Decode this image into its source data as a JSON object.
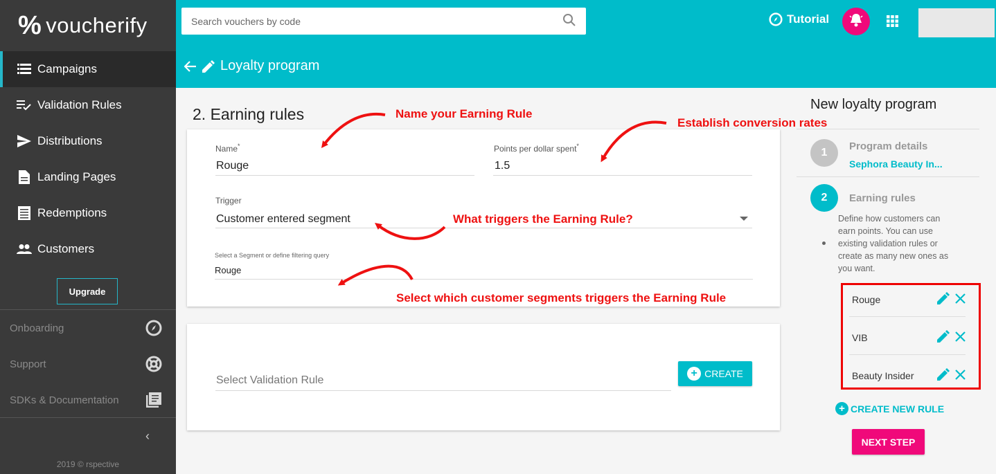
{
  "app": {
    "logo_text": "voucherify",
    "logo_mark": "%"
  },
  "sidebar": {
    "items": [
      {
        "label": "Campaigns",
        "icon": "list-icon"
      },
      {
        "label": "Validation Rules",
        "icon": "checklist-icon"
      },
      {
        "label": "Distributions",
        "icon": "send-icon"
      },
      {
        "label": "Landing Pages",
        "icon": "document-icon"
      },
      {
        "label": "Redemptions",
        "icon": "receipt-icon"
      },
      {
        "label": "Customers",
        "icon": "people-icon"
      }
    ],
    "upgrade_label": "Upgrade",
    "secondary": [
      {
        "label": "Onboarding",
        "icon": "compass-icon"
      },
      {
        "label": "Support",
        "icon": "lifebuoy-icon"
      },
      {
        "label": "SDKs & Documentation",
        "icon": "book-icon"
      }
    ],
    "copyright": "2019 © rspective"
  },
  "header": {
    "search_placeholder": "Search vouchers by code",
    "tutorial_label": "Tutorial",
    "page_title": "Loyalty program"
  },
  "form": {
    "section_title": "2. Earning rules",
    "name_label": "Name",
    "name_value": "Rouge",
    "points_label": "Points per dollar spent",
    "points_value": "1.5",
    "trigger_label": "Trigger",
    "trigger_value": "Customer entered segment",
    "segment_label": "Select a Segment or define filtering query",
    "segment_value": "Rouge",
    "validation_placeholder": "Select Validation Rule",
    "create_label": "CREATE",
    "required_mark": "*"
  },
  "annotations": {
    "name": "Name your Earning Rule",
    "conversion": "Establish conversion rates",
    "trigger": "What triggers the Earning Rule?",
    "segments": "Select which customer segments triggers the Earning Rule"
  },
  "right_panel": {
    "title": "New loyalty program",
    "steps": [
      {
        "number": "1",
        "title": "Program details",
        "subtitle": "Sephora Beauty In..."
      },
      {
        "number": "2",
        "title": "Earning rules",
        "description": "Define how customers can earn points. You can use existing validation rules or create as many new ones as you want."
      }
    ],
    "rules": [
      "Rouge",
      "VIB",
      "Beauty Insider"
    ],
    "create_new_label": "CREATE NEW RULE",
    "next_label": "NEXT STEP"
  },
  "colors": {
    "accent": "#00bcca",
    "pink": "#f0097a",
    "annotation": "#ee1111",
    "sidebar": "#3a3a3a"
  }
}
